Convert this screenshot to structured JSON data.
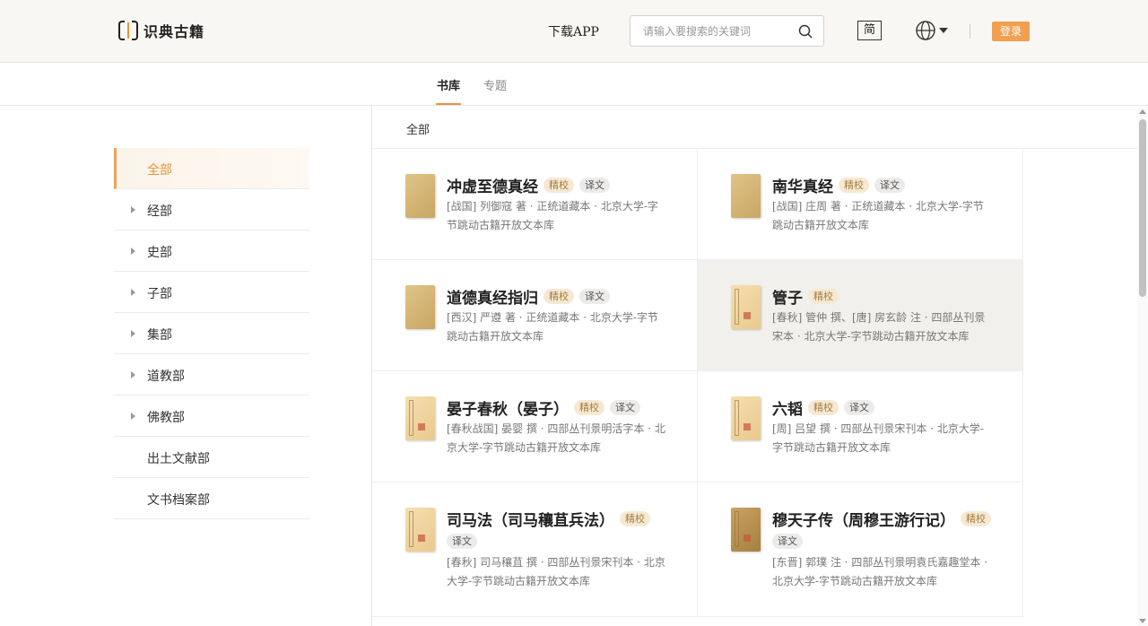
{
  "header": {
    "logo_text": "识典古籍",
    "download_label": "下载APP",
    "search_placeholder": "请输入要搜索的关键词",
    "simplified_label": "简",
    "login_label": "登录"
  },
  "tabs": [
    {
      "label": "书库",
      "active": true
    },
    {
      "label": "专题",
      "active": false
    }
  ],
  "sidebar": {
    "items": [
      {
        "label": "全部",
        "active": true,
        "expandable": false
      },
      {
        "label": "经部",
        "active": false,
        "expandable": true
      },
      {
        "label": "史部",
        "active": false,
        "expandable": true
      },
      {
        "label": "子部",
        "active": false,
        "expandable": true
      },
      {
        "label": "集部",
        "active": false,
        "expandable": true
      },
      {
        "label": "道教部",
        "active": false,
        "expandable": true
      },
      {
        "label": "佛教部",
        "active": false,
        "expandable": true
      },
      {
        "label": "出土文献部",
        "active": false,
        "expandable": false
      },
      {
        "label": "文书档案部",
        "active": false,
        "expandable": false
      }
    ]
  },
  "breadcrumb": "全部",
  "books": [
    {
      "title": "冲虚至德真经",
      "tags": [
        "精校",
        "译文"
      ],
      "meta": "[战国] 列御寇 著 · 正统道藏本 · 北京大学-字节跳动古籍开放文本库"
    },
    {
      "title": "南华真经",
      "tags": [
        "精校",
        "译文"
      ],
      "meta": "[战国] 庄周 著 · 正统道藏本 · 北京大学-字节跳动古籍开放文本库"
    },
    {
      "title": "道德真经指归",
      "tags": [
        "精校",
        "译文"
      ],
      "meta": "[西汉] 严遵 著 · 正统道藏本 · 北京大学-字节跳动古籍开放文本库"
    },
    {
      "title": "管子",
      "tags": [
        "精校"
      ],
      "meta": "[春秋] 管仲 撰、[唐] 房玄龄 注 · 四部丛刊景宋本 · 北京大学-字节跳动古籍开放文本库"
    },
    {
      "title": "晏子春秋（晏子）",
      "tags": [
        "精校",
        "译文"
      ],
      "meta": "[春秋战国] 晏婴 撰 · 四部丛刊景明活字本 · 北京大学-字节跳动古籍开放文本库"
    },
    {
      "title": "六韬",
      "tags": [
        "精校",
        "译文"
      ],
      "meta": "[周] 吕望 撰 · 四部丛刊景宋刊本 · 北京大学-字节跳动古籍开放文本库"
    },
    {
      "title": "司马法（司马穰苴兵法）",
      "tags": [
        "精校",
        "译文"
      ],
      "meta": "[春秋] 司马穰苴 撰 · 四部丛刊景宋刊本 · 北京大学-字节跳动古籍开放文本库"
    },
    {
      "title": "穆天子传（周穆王游行记）",
      "tags": [
        "精校",
        "译文"
      ],
      "meta": "[东晋] 郭璞 注 · 四部丛刊景明袁氏嘉趣堂本 · 北京大学-字节跳动古籍开放文本库"
    }
  ]
}
